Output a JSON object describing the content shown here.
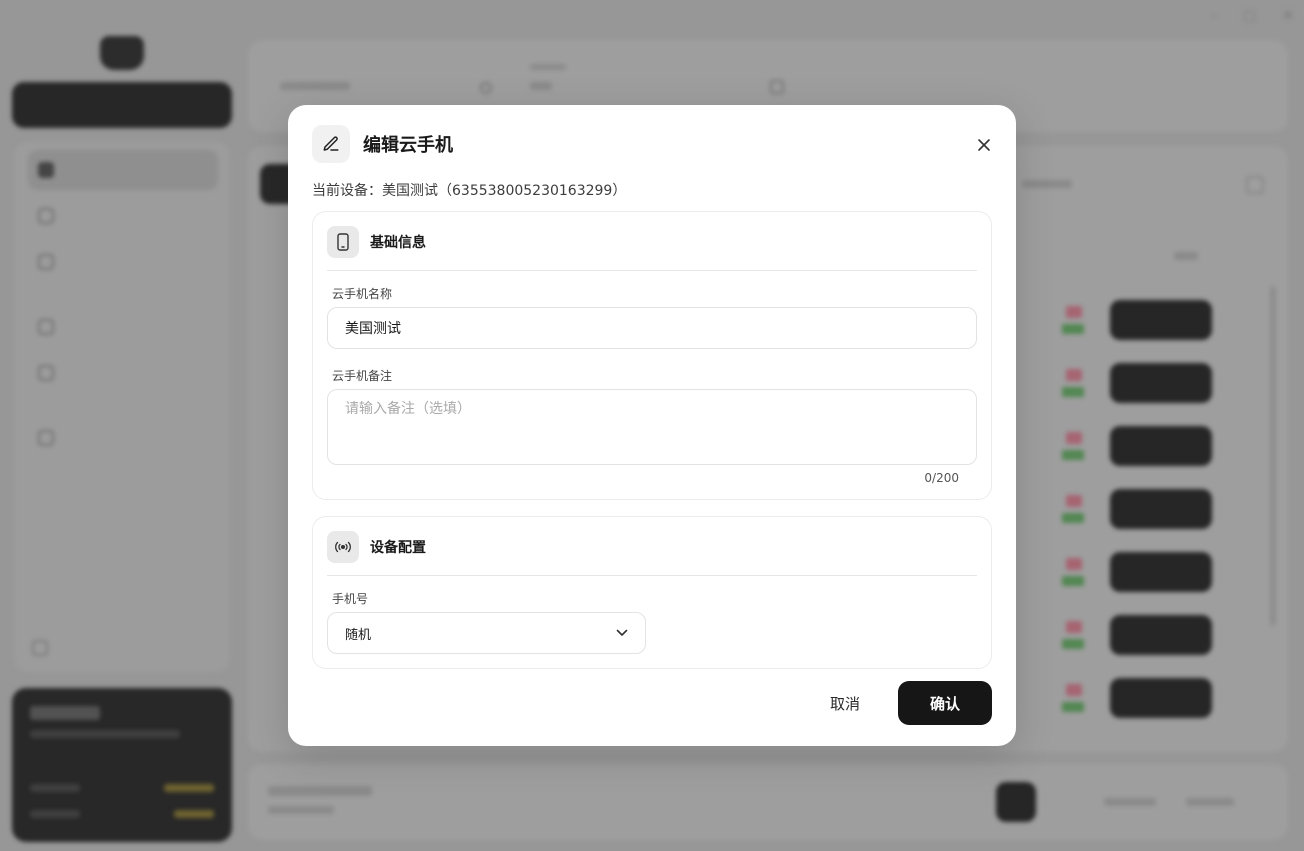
{
  "modal": {
    "title": "编辑云手机",
    "device_label": "当前设备：",
    "device_value": "美国测试（635538005230163299）",
    "section_basic": {
      "title": "基础信息",
      "name_label": "云手机名称",
      "name_value": "美国测试",
      "note_label": "云手机备注",
      "note_placeholder": "请输入备注（选填）",
      "note_counter": "0/200"
    },
    "section_device": {
      "title": "设备配置",
      "phone_label": "手机号",
      "phone_value": "随机"
    },
    "cancel_label": "取消",
    "confirm_label": "确认"
  },
  "colors": {
    "primary": "#161616",
    "overlay": "#9e9e9e",
    "modal_bg": "#ffffff"
  }
}
